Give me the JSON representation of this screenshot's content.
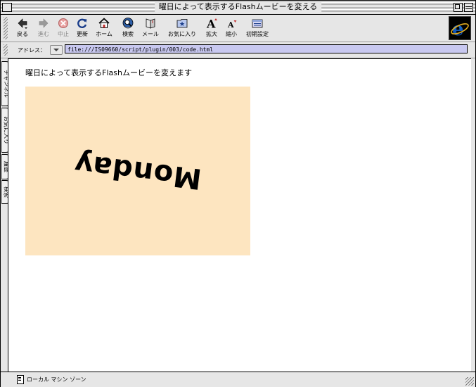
{
  "window": {
    "title": "曜日によって表示するFlashムービーを変える"
  },
  "toolbar": {
    "buttons": [
      {
        "label": "戻る",
        "icon": "back-arrow-icon"
      },
      {
        "label": "進む",
        "icon": "forward-arrow-icon"
      },
      {
        "label": "中止",
        "icon": "stop-icon"
      },
      {
        "label": "更新",
        "icon": "refresh-icon"
      },
      {
        "label": "ホーム",
        "icon": "home-icon"
      },
      {
        "label": "検索",
        "icon": "search-icon"
      },
      {
        "label": "メール",
        "icon": "mail-icon"
      },
      {
        "label": "お気に入り",
        "icon": "favorites-icon"
      },
      {
        "label": "拡大",
        "icon": "text-larger-icon"
      },
      {
        "label": "縮小",
        "icon": "text-smaller-icon"
      },
      {
        "label": "初期設定",
        "icon": "preferences-icon"
      }
    ]
  },
  "address": {
    "label": "アドレス：",
    "url": "file:///IS09660/script/plugin/003/code.html"
  },
  "side_tabs": [
    "チャンネル",
    "お気に入り",
    "履歴",
    "検索"
  ],
  "page": {
    "heading": "曜日によって表示するFlashムービーを変えます",
    "flash": {
      "text": "Monday",
      "background": "#fde5c0"
    }
  },
  "status": {
    "text": "ローカル マシン ゾーン"
  }
}
